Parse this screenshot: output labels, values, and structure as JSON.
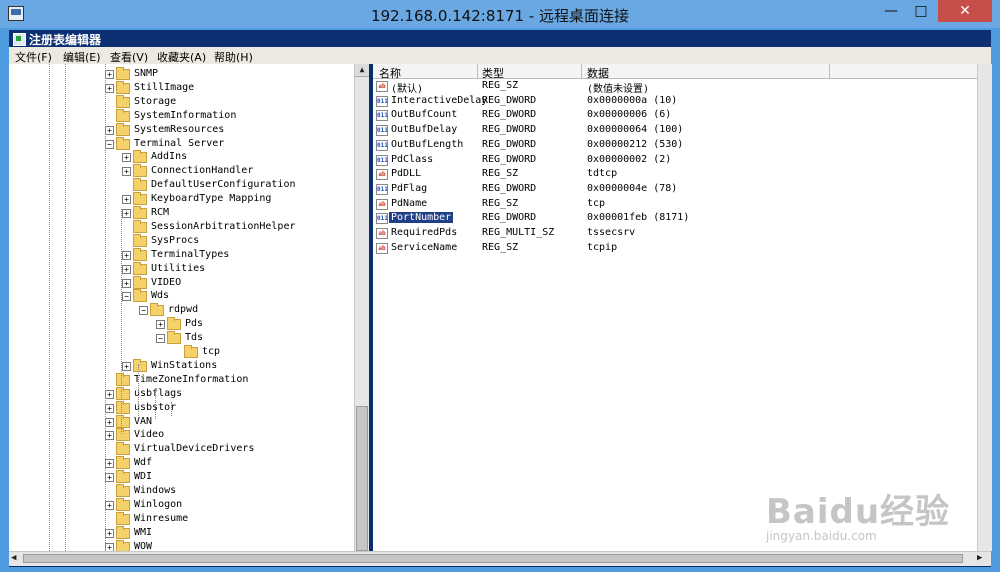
{
  "remote_window": {
    "title": "192.168.0.142:8171 - 远程桌面连接",
    "min_label": "—",
    "max_label": "□",
    "close_label": "✕"
  },
  "regedit": {
    "title": "注册表编辑器",
    "menu": [
      "文件(F)",
      "编辑(E)",
      "查看(V)",
      "收藏夹(A)",
      "帮助(H)"
    ]
  },
  "tree": {
    "items": [
      {
        "label": "SNMP",
        "level": 0,
        "expander": "+"
      },
      {
        "label": "StillImage",
        "level": 0,
        "expander": "+"
      },
      {
        "label": "Storage",
        "level": 0,
        "expander": ""
      },
      {
        "label": "SystemInformation",
        "level": 0,
        "expander": ""
      },
      {
        "label": "SystemResources",
        "level": 0,
        "expander": "+"
      },
      {
        "label": "Terminal Server",
        "level": 0,
        "expander": "−"
      },
      {
        "label": "AddIns",
        "level": 1,
        "expander": "+"
      },
      {
        "label": "ConnectionHandler",
        "level": 1,
        "expander": "+"
      },
      {
        "label": "DefaultUserConfiguration",
        "level": 1,
        "expander": ""
      },
      {
        "label": "KeyboardType Mapping",
        "level": 1,
        "expander": "+"
      },
      {
        "label": "RCM",
        "level": 1,
        "expander": "+"
      },
      {
        "label": "SessionArbitrationHelper",
        "level": 1,
        "expander": ""
      },
      {
        "label": "SysProcs",
        "level": 1,
        "expander": ""
      },
      {
        "label": "TerminalTypes",
        "level": 1,
        "expander": "+"
      },
      {
        "label": "Utilities",
        "level": 1,
        "expander": "+"
      },
      {
        "label": "VIDEO",
        "level": 1,
        "expander": "+"
      },
      {
        "label": "Wds",
        "level": 1,
        "expander": "−"
      },
      {
        "label": "rdpwd",
        "level": 2,
        "expander": "−"
      },
      {
        "label": "Pds",
        "level": 3,
        "expander": "+"
      },
      {
        "label": "Tds",
        "level": 3,
        "expander": "−"
      },
      {
        "label": "tcp",
        "level": 4,
        "expander": ""
      },
      {
        "label": "WinStations",
        "level": 1,
        "expander": "+"
      },
      {
        "label": "TimeZoneInformation",
        "level": 0,
        "expander": ""
      },
      {
        "label": "usbflags",
        "level": 0,
        "expander": "+"
      },
      {
        "label": "usbstor",
        "level": 0,
        "expander": "+"
      },
      {
        "label": "VAN",
        "level": 0,
        "expander": "+"
      },
      {
        "label": "Video",
        "level": 0,
        "expander": "+"
      },
      {
        "label": "VirtualDeviceDrivers",
        "level": 0,
        "expander": ""
      },
      {
        "label": "Wdf",
        "level": 0,
        "expander": "+"
      },
      {
        "label": "WDI",
        "level": 0,
        "expander": "+"
      },
      {
        "label": "Windows",
        "level": 0,
        "expander": ""
      },
      {
        "label": "Winlogon",
        "level": 0,
        "expander": "+"
      },
      {
        "label": "Winresume",
        "level": 0,
        "expander": ""
      },
      {
        "label": "WMI",
        "level": 0,
        "expander": "+"
      },
      {
        "label": "WOW",
        "level": 0,
        "expander": "+"
      }
    ]
  },
  "list": {
    "headers": {
      "name": "名称",
      "type": "类型",
      "data": "数据"
    },
    "rows": [
      {
        "icon": "ab",
        "name": "(默认)",
        "type": "REG_SZ",
        "data": "(数值未设置)"
      },
      {
        "icon": "num",
        "name": "InteractiveDelay",
        "type": "REG_DWORD",
        "data": "0x0000000a (10)"
      },
      {
        "icon": "num",
        "name": "OutBufCount",
        "type": "REG_DWORD",
        "data": "0x00000006 (6)"
      },
      {
        "icon": "num",
        "name": "OutBufDelay",
        "type": "REG_DWORD",
        "data": "0x00000064 (100)"
      },
      {
        "icon": "num",
        "name": "OutBufLength",
        "type": "REG_DWORD",
        "data": "0x00000212 (530)"
      },
      {
        "icon": "num",
        "name": "PdClass",
        "type": "REG_DWORD",
        "data": "0x00000002 (2)"
      },
      {
        "icon": "ab",
        "name": "PdDLL",
        "type": "REG_SZ",
        "data": "tdtcp"
      },
      {
        "icon": "num",
        "name": "PdFlag",
        "type": "REG_DWORD",
        "data": "0x0000004e (78)"
      },
      {
        "icon": "ab",
        "name": "PdName",
        "type": "REG_SZ",
        "data": "tcp"
      },
      {
        "icon": "num",
        "name": "PortNumber",
        "type": "REG_DWORD",
        "data": "0x00001feb (8171)",
        "selected": true
      },
      {
        "icon": "ab",
        "name": "RequiredPds",
        "type": "REG_MULTI_SZ",
        "data": "tssecsrv"
      },
      {
        "icon": "ab",
        "name": "ServiceName",
        "type": "REG_SZ",
        "data": "tcpip"
      }
    ]
  },
  "icon_text": {
    "ab": "ab",
    "num": "011"
  },
  "watermark": {
    "big": "Baidu经验",
    "small": "jingyan.baidu.com"
  },
  "colors": {
    "selection": "#1f3f86",
    "desktop": "#4f9be0",
    "close": "#c74f4a"
  }
}
